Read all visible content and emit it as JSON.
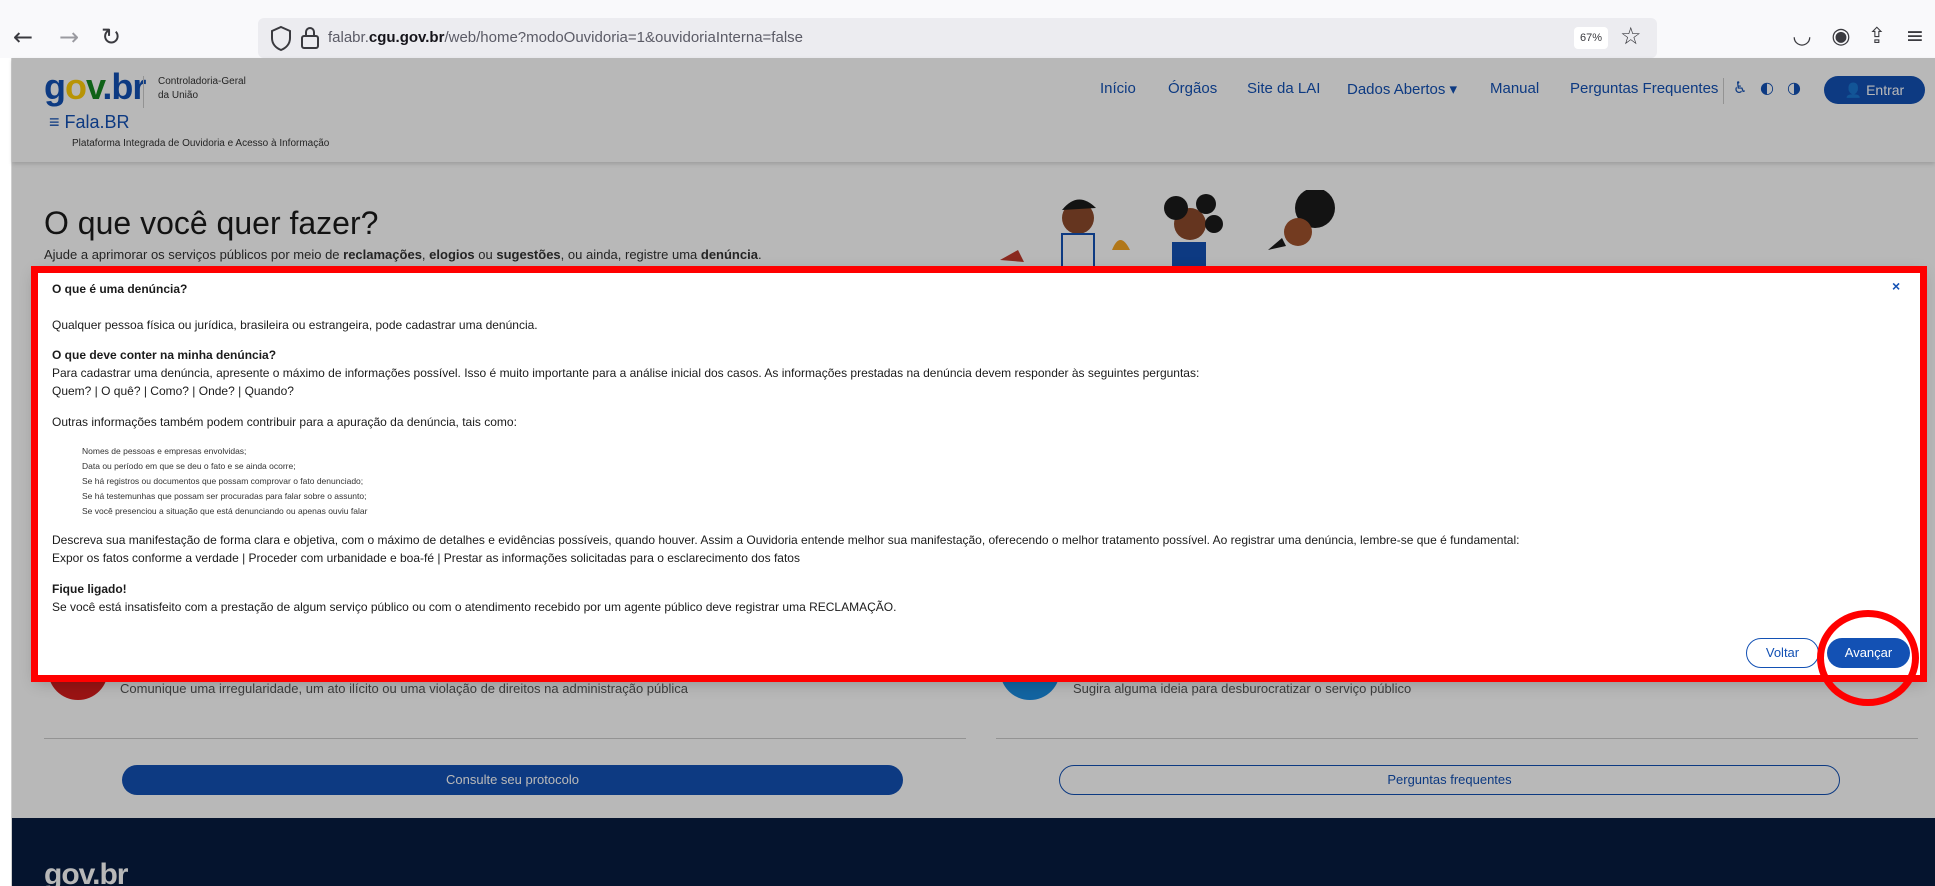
{
  "browser": {
    "back_icon": "←",
    "forward_icon": "→",
    "reload_icon": "↻",
    "url_prefix": "falabr.",
    "url_domain": "cgu.gov.br",
    "url_path": "/web/home?modoOuvidoria=1&ouvidoriaInterna=false",
    "zoom": "67%",
    "bookmark_icon": "☆",
    "pocket_icon": "◡",
    "account_icon": "◉",
    "share_icon": "⇪",
    "menu_icon": "≡"
  },
  "header": {
    "logo": {
      "g": "g",
      "o": "o",
      "v": "v",
      "dot": ".",
      "br": "br"
    },
    "org_line1": "Controladoria-Geral",
    "org_line2": "da União",
    "app_name": "≡  Fala.BR",
    "app_subtitle": "Plataforma Integrada de Ouvidoria e Acesso à Informação",
    "nav": [
      "Início",
      "Órgãos",
      "Site da LAI",
      "Dados Abertos ▾",
      "Manual",
      "Perguntas Frequentes"
    ],
    "a11y": [
      "♿",
      "◐",
      "◑"
    ],
    "login_label": "👤 Entrar"
  },
  "hero": {
    "title": "O que você quer fazer?",
    "sub_a": "Ajude a aprimorar os serviços públicos por meio de ",
    "sub_b": "reclamações",
    "sub_c": ", ",
    "sub_d": "elogios",
    "sub_e": " ou ",
    "sub_f": "sugestões",
    "sub_g": ", ou ainda, registre uma ",
    "sub_h": "denúncia",
    "sub_i": "."
  },
  "behind": {
    "left_desc": "Comunique uma irregularidade, um ato ilícito ou uma violação de direitos na administração pública",
    "right_desc": "Sugira alguma ideia para desburocratizar o serviço público",
    "consulte": "Consulte seu protocolo",
    "perguntas": "Perguntas frequentes",
    "footer_logo": "gov.br"
  },
  "modal": {
    "title": "O que é uma denúncia?",
    "close": "×",
    "p1": "Qualquer pessoa física ou jurídica, brasileira ou estrangeira, pode cadastrar uma denúncia.",
    "h2": "O que deve conter na minha denúncia?",
    "p2": "Para cadastrar uma denúncia, apresente o máximo de informações possível. Isso é muito importante para a análise inicial dos casos. As informações prestadas na denúncia devem responder às seguintes perguntas:",
    "p3": "Quem? | O quê? | Como? | Onde? | Quando?",
    "p4": "Outras informações também podem contribuir para a apuração da denúncia, tais como:",
    "list": [
      "Nomes de pessoas e empresas envolvidas;",
      "Data ou período em que se deu o fato e se ainda ocorre;",
      "Se há registros ou documentos que possam comprovar o fato denunciado;",
      "Se há testemunhas que possam ser procuradas para falar sobre o assunto;",
      "Se você presenciou a situação que está denunciando ou apenas ouviu falar"
    ],
    "p5": "Descreva sua manifestação de forma clara e objetiva, com o máximo de detalhes e evidências possíveis, quando houver. Assim a Ouvidoria entende melhor sua manifestação, oferecendo o melhor tratamento possível. Ao registrar uma denúncia, lembre-se que é fundamental:",
    "p6": "Expor os fatos conforme a verdade | Proceder com urbanidade e boa-fé | Prestar as informações solicitadas para o esclarecimento dos fatos",
    "h3": "Fique ligado!",
    "p7": "Se você está insatisfeito com a prestação de algum serviço público ou com o atendimento recebido por um agente público deve registrar uma RECLAMAÇÃO.",
    "back_label": "Voltar",
    "next_label": "Avançar"
  },
  "colors": {
    "primary": "#1351b4",
    "annotation": "#ff0000",
    "footer": "#071d41"
  }
}
